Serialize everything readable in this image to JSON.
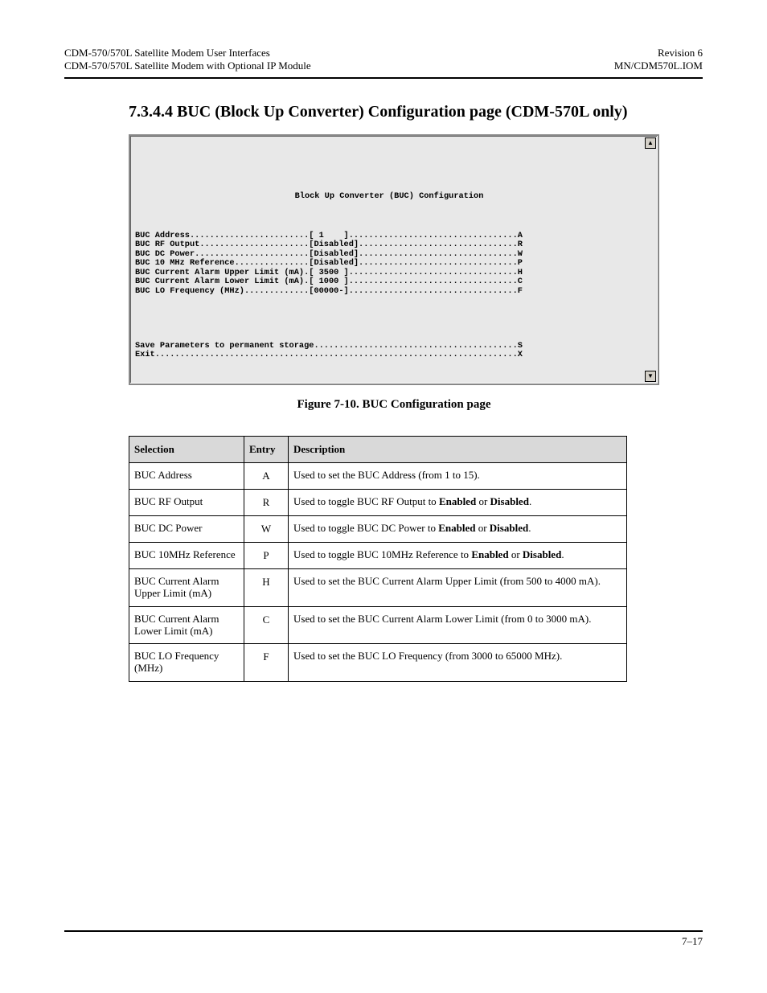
{
  "header": {
    "left_l1": "CDM-570/570L Satellite Modem User Interfaces",
    "left_l2": "CDM-570/570L Satellite Modem with Optional IP Module",
    "right_l1": "Revision 6",
    "right_l2": "MN/CDM570L.IOM"
  },
  "section_title": "7.3.4.4   BUC (Block Up Converter) Configuration page (CDM-570L only)",
  "figure_caption": "Figure 7-10. BUC Configuration page",
  "console": {
    "title": "Block Up Converter (BUC) Configuration",
    "rows": [
      {
        "label": "BUC Address",
        "value": "[ 1    ]",
        "hot": "A"
      },
      {
        "label": "BUC RF Output",
        "value": "[Disabled]",
        "hot": "R"
      },
      {
        "label": "BUC DC Power",
        "value": "[Disabled]",
        "hot": "W"
      },
      {
        "label": "BUC 10 MHz Reference",
        "value": "[Disabled]",
        "hot": "P"
      },
      {
        "label": "BUC Current Alarm Upper Limit (mA)",
        "value": "[ 3500 ]",
        "hot": "H"
      },
      {
        "label": "BUC Current Alarm Lower Limit (mA)",
        "value": "[ 1000 ]",
        "hot": "C"
      },
      {
        "label": "BUC LO Frequency (MHz)",
        "value": "[00000-]",
        "hot": "F"
      }
    ],
    "footer_rows": [
      {
        "label": "Save Parameters to permanent storage",
        "hot": "S"
      },
      {
        "label": "Exit",
        "hot": "X"
      }
    ]
  },
  "table": {
    "headers": [
      "Selection",
      "Entry",
      "Description"
    ],
    "rows": [
      {
        "sel": "BUC Address",
        "entry": "A",
        "desc": "Used to set the BUC Address (from 1 to 15)."
      },
      {
        "sel": "BUC RF Output",
        "entry": "R",
        "desc": "Used to toggle BUC RF Output to Enabled or Disabled."
      },
      {
        "sel": "BUC DC Power",
        "entry": "W",
        "desc": "Used to toggle BUC DC Power to Enabled or Disabled."
      },
      {
        "sel": "BUC 10MHz Reference",
        "entry": "P",
        "desc": "Used to toggle BUC 10MHz Reference to Enabled or Disabled."
      },
      {
        "sel": "BUC Current Alarm Upper Limit (mA)",
        "entry": "H",
        "desc": "Used to set the BUC Current Alarm Upper Limit (from 500 to 4000 mA)."
      },
      {
        "sel": "BUC Current Alarm Lower Limit (mA)",
        "entry": "C",
        "desc": "Used to set the BUC Current Alarm Lower Limit (from 0 to 3000 mA)."
      },
      {
        "sel": "BUC LO Frequency (MHz)",
        "entry": "F",
        "desc": "Used to set the BUC LO Frequency (from 3000 to 65000 MHz)."
      }
    ]
  },
  "footer": {
    "page": "7–17"
  }
}
